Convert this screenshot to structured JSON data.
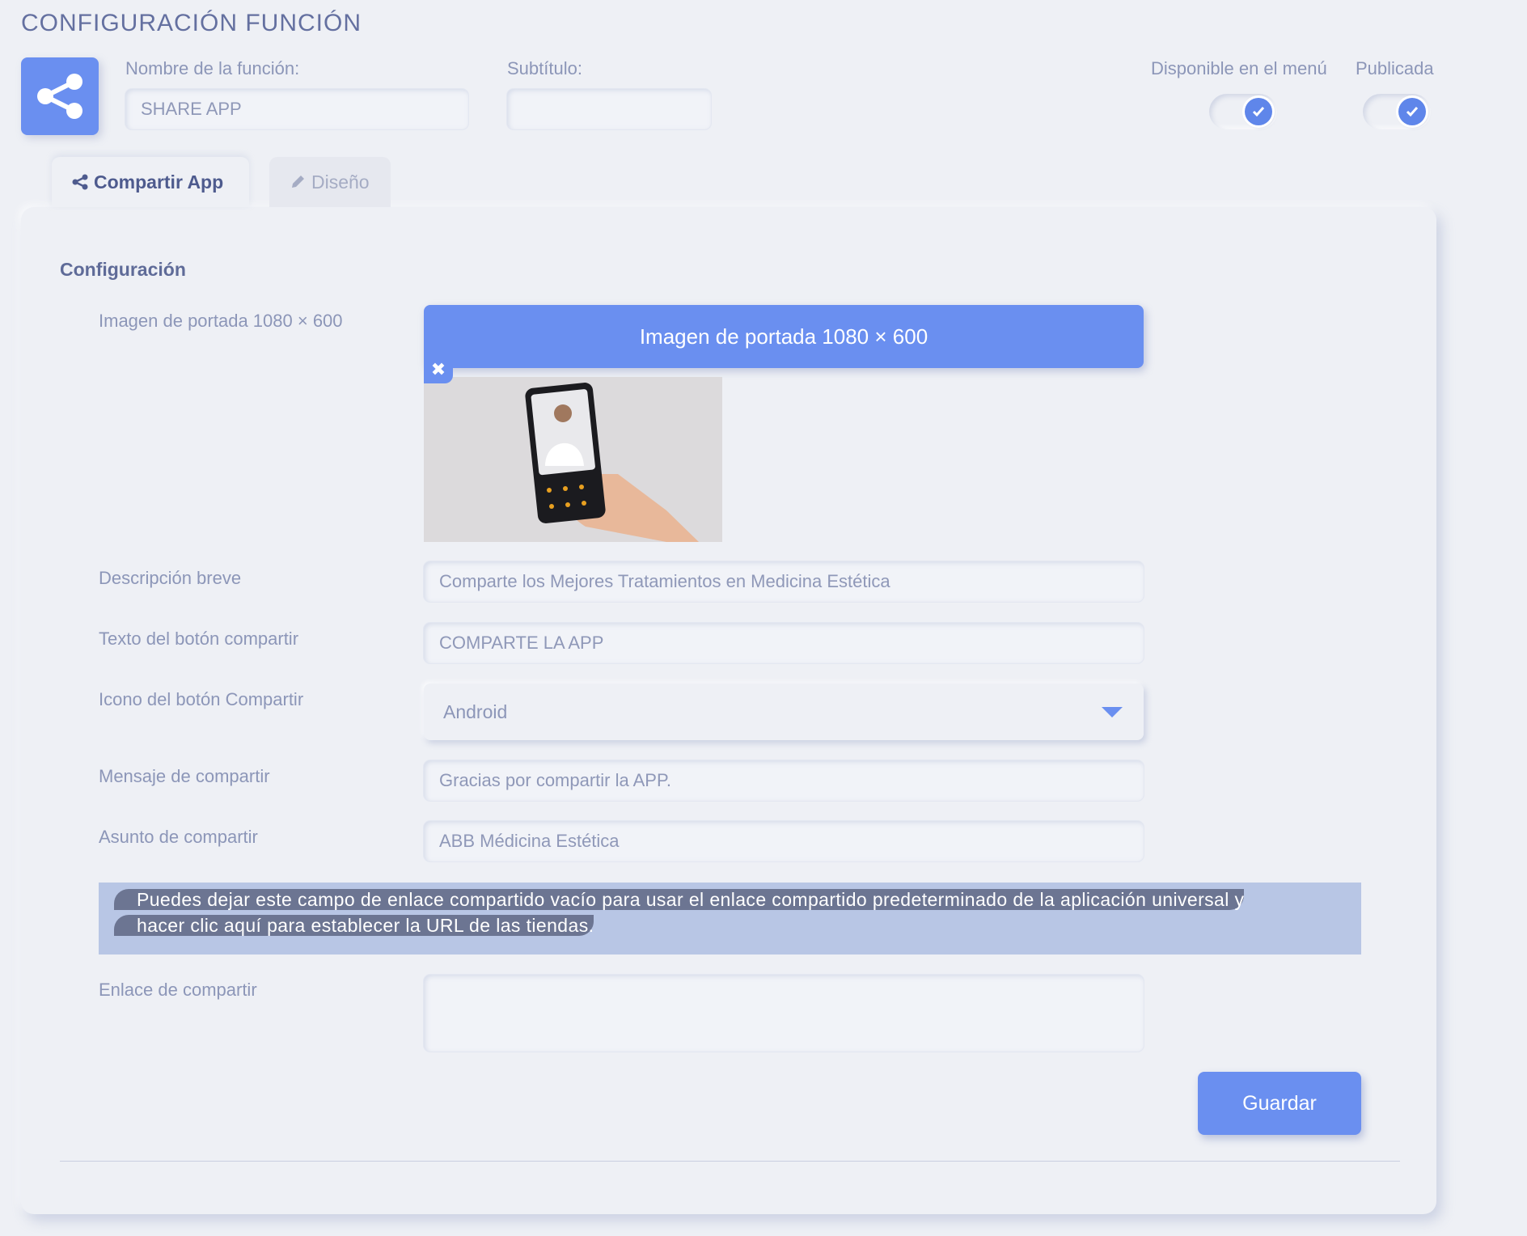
{
  "page_title": "CONFIGURACIÓN FUNCIÓN",
  "header": {
    "name_label": "Nombre de la función:",
    "name_value": "SHARE APP",
    "subtitle_label": "Subtítulo:",
    "subtitle_value": "",
    "menu_label": "Disponible en el menú",
    "menu_checked": true,
    "published_label": "Publicada",
    "published_checked": true
  },
  "tabs": [
    {
      "label": "Compartir App",
      "icon": "share-icon",
      "active": true
    },
    {
      "label": "Diseño",
      "icon": "pencil-icon",
      "active": false
    }
  ],
  "form": {
    "section_title": "Configuración",
    "cover_label": "Imagen de portada 1080 × 600",
    "cover_button": "Imagen de portada 1080 × 600",
    "remove_symbol": "✖",
    "desc_label": "Descripción breve",
    "desc_value": "Comparte los Mejores Tratamientos en Medicina Estética",
    "button_text_label": "Texto del botón compartir",
    "button_text_value": "COMPARTE LA APP",
    "icon_label": "Icono del botón Compartir",
    "icon_value": "Android",
    "message_label": "Mensaje de compartir",
    "message_value": "Gracias por compartir la APP.",
    "subject_label": "Asunto de compartir",
    "subject_value": "ABB Médicina Estética",
    "note": "Puedes dejar este campo de enlace compartido vacío para usar el enlace compartido predeterminado de la aplicación universal y hacer clic aquí para establecer la URL de las tiendas.",
    "link_label": "Enlace de compartir",
    "link_value": "",
    "save_button": "Guardar"
  },
  "colors": {
    "accent": "#6a8ff0",
    "background": "#eef0f5",
    "note_bg": "#b8c6e5"
  }
}
